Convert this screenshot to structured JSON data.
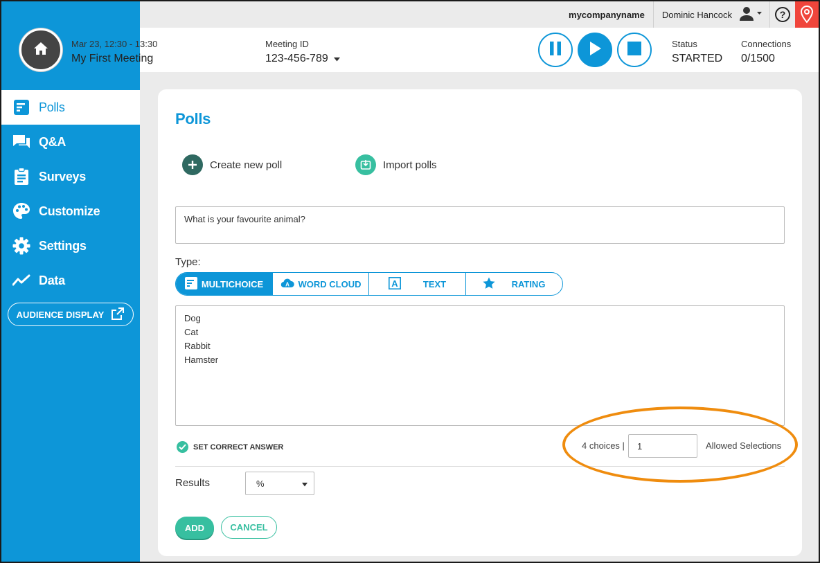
{
  "topbar": {
    "company": "mycompanyname",
    "user_name": "Dominic Hancock",
    "icons": [
      "user-icon",
      "chevron-down-icon",
      "help-icon",
      "location-pin-icon"
    ]
  },
  "meeting": {
    "date": "Mar 23, 12:30 - 13:30",
    "title": "My First Meeting",
    "id_label": "Meeting ID",
    "id": "123-456-789",
    "status_label": "Status",
    "status": "STARTED",
    "connections_label": "Connections",
    "connections": "0/1500",
    "controls": [
      "pause-icon",
      "play-icon",
      "stop-icon"
    ]
  },
  "sidebar": {
    "items": [
      {
        "label": "Polls",
        "icon": "polls-icon",
        "active": true
      },
      {
        "label": "Q&A",
        "icon": "chat-icon"
      },
      {
        "label": "Surveys",
        "icon": "clipboard-icon"
      },
      {
        "label": "Customize",
        "icon": "palette-icon"
      },
      {
        "label": "Settings",
        "icon": "gear-icon"
      },
      {
        "label": "Data",
        "icon": "chart-line-icon"
      }
    ],
    "audience_display": "AUDIENCE DISPLAY"
  },
  "polls": {
    "title": "Polls",
    "create_label": "Create new poll",
    "import_label": "Import polls",
    "question": "What is your favourite animal?",
    "type_label": "Type:",
    "types": [
      {
        "label": "MULTICHOICE",
        "active": true
      },
      {
        "label": "WORD CLOUD"
      },
      {
        "label": "TEXT"
      },
      {
        "label": "RATING"
      }
    ],
    "choices": "Dog\nCat\nRabbit\nHamster",
    "set_correct": "SET CORRECT ANSWER",
    "choice_count": "4 choices |",
    "allowed_value": "1",
    "allowed_label": "Allowed Selections",
    "results_label": "Results",
    "results_value": "%",
    "add": "ADD",
    "cancel": "CANCEL"
  },
  "colors": {
    "brand_blue": "#0d96d8",
    "accent_green": "#37bfa0",
    "highlight_orange": "#ef8c0e",
    "alert_red": "#f0453b"
  }
}
